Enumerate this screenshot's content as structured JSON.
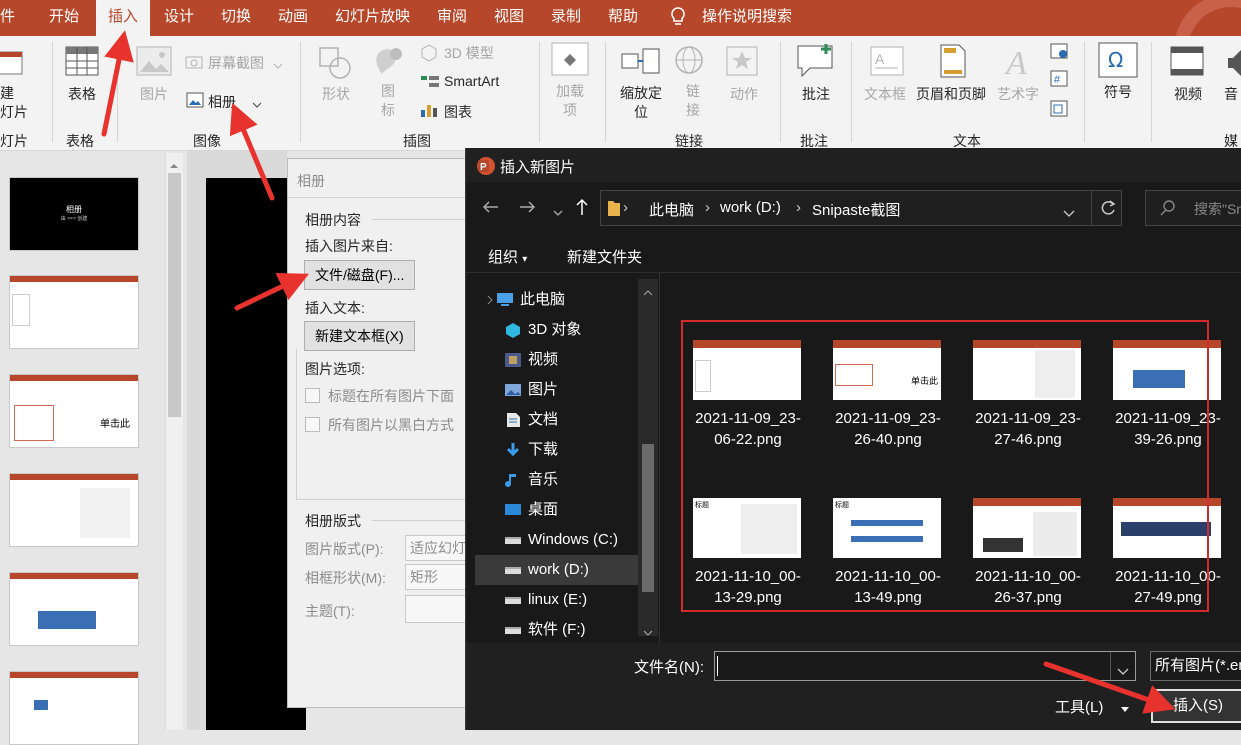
{
  "menubar": {
    "tabs": [
      "件",
      "开始",
      "插入",
      "设计",
      "切换",
      "动画",
      "幻灯片放映",
      "审阅",
      "视图",
      "录制",
      "帮助"
    ],
    "search_label": "操作说明搜索"
  },
  "ribbon": {
    "partial_new_slide": "建\n灯片",
    "table": "表格",
    "pictures": "图片",
    "screenshot": "屏幕截图",
    "album": "相册",
    "shapes": "形状",
    "icons": "图\n标",
    "model3d": "3D 模型",
    "smartart": "SmartArt",
    "chart": "图表",
    "addins": "加载\n项",
    "zoom": "缩放定\n位",
    "link": "链\n接",
    "action": "动作",
    "comment": "批注",
    "textbox": "文本框",
    "header_footer": "页眉和页脚",
    "wordart": "艺术字",
    "symbol": "符号",
    "video": "视频",
    "audio": "音",
    "groups": {
      "slides": "灯片",
      "tables": "表格",
      "images": "图像",
      "illustrations": "插图",
      "links": "链接",
      "comments": "批注",
      "text": "文本",
      "media": "媒"
    }
  },
  "thumbnails": {
    "slide1_title": "相册",
    "slide1_sub": "由 ××× 创建",
    "slide3_text": "单击此"
  },
  "album_dialog": {
    "title": "相册",
    "content_header": "相册内容",
    "insert_from": "插入图片来自:",
    "file_disk_button": "文件/磁盘(F)...",
    "insert_text": "插入文本:",
    "new_textbox_button": "新建文本框(X)",
    "picture_options": "图片选项:",
    "caption_option": "标题在所有图片下面",
    "bw_option": "所有图片以黑白方式",
    "layout_header": "相册版式",
    "picture_layout_label": "图片版式(P):",
    "picture_layout_value": "适应幻灯",
    "frame_shape_label": "相框形状(M):",
    "frame_shape_value": "矩形",
    "theme_label": "主题(T):"
  },
  "file_dialog": {
    "title": "插入新图片",
    "breadcrumb": [
      "此电脑",
      "work (D:)",
      "Snipaste截图"
    ],
    "search_placeholder": "搜索\"Sn",
    "organize": "组织",
    "new_folder": "新建文件夹",
    "nav": [
      {
        "label": "此电脑",
        "icon": "pc-icon"
      },
      {
        "label": "3D 对象",
        "icon": "cube-icon"
      },
      {
        "label": "视频",
        "icon": "film-icon"
      },
      {
        "label": "图片",
        "icon": "image-icon"
      },
      {
        "label": "文档",
        "icon": "document-icon"
      },
      {
        "label": "下载",
        "icon": "download-icon"
      },
      {
        "label": "音乐",
        "icon": "music-icon"
      },
      {
        "label": "桌面",
        "icon": "desktop-icon"
      },
      {
        "label": "Windows (C:)",
        "icon": "drive-icon"
      },
      {
        "label": "work (D:)",
        "icon": "drive-icon"
      },
      {
        "label": "linux (E:)",
        "icon": "drive-icon"
      },
      {
        "label": "软件 (F:)",
        "icon": "drive-icon"
      }
    ],
    "files": [
      {
        "line1": "2021-11-09_23-",
        "line2": "06-22.png"
      },
      {
        "line1": "2021-11-09_23-",
        "line2": "26-40.png"
      },
      {
        "line1": "2021-11-09_23-",
        "line2": "27-46.png"
      },
      {
        "line1": "2021-11-09_23-",
        "line2": "39-26.png"
      },
      {
        "line1": "2021-11-10_00-",
        "line2": "13-29.png"
      },
      {
        "line1": "2021-11-10_00-",
        "line2": "13-49.png"
      },
      {
        "line1": "2021-11-10_00-",
        "line2": "26-37.png"
      },
      {
        "line1": "2021-11-10_00-",
        "line2": "27-49.png"
      }
    ],
    "filename_label": "文件名(N):",
    "filename_value": "",
    "filetype_value": "所有图片(*.em",
    "tools_label": "工具(L)",
    "insert_button": "插入(S)"
  },
  "colors": {
    "accent": "#b7472a",
    "annotation_red": "#e8322e",
    "dialog_dark": "#191919"
  }
}
